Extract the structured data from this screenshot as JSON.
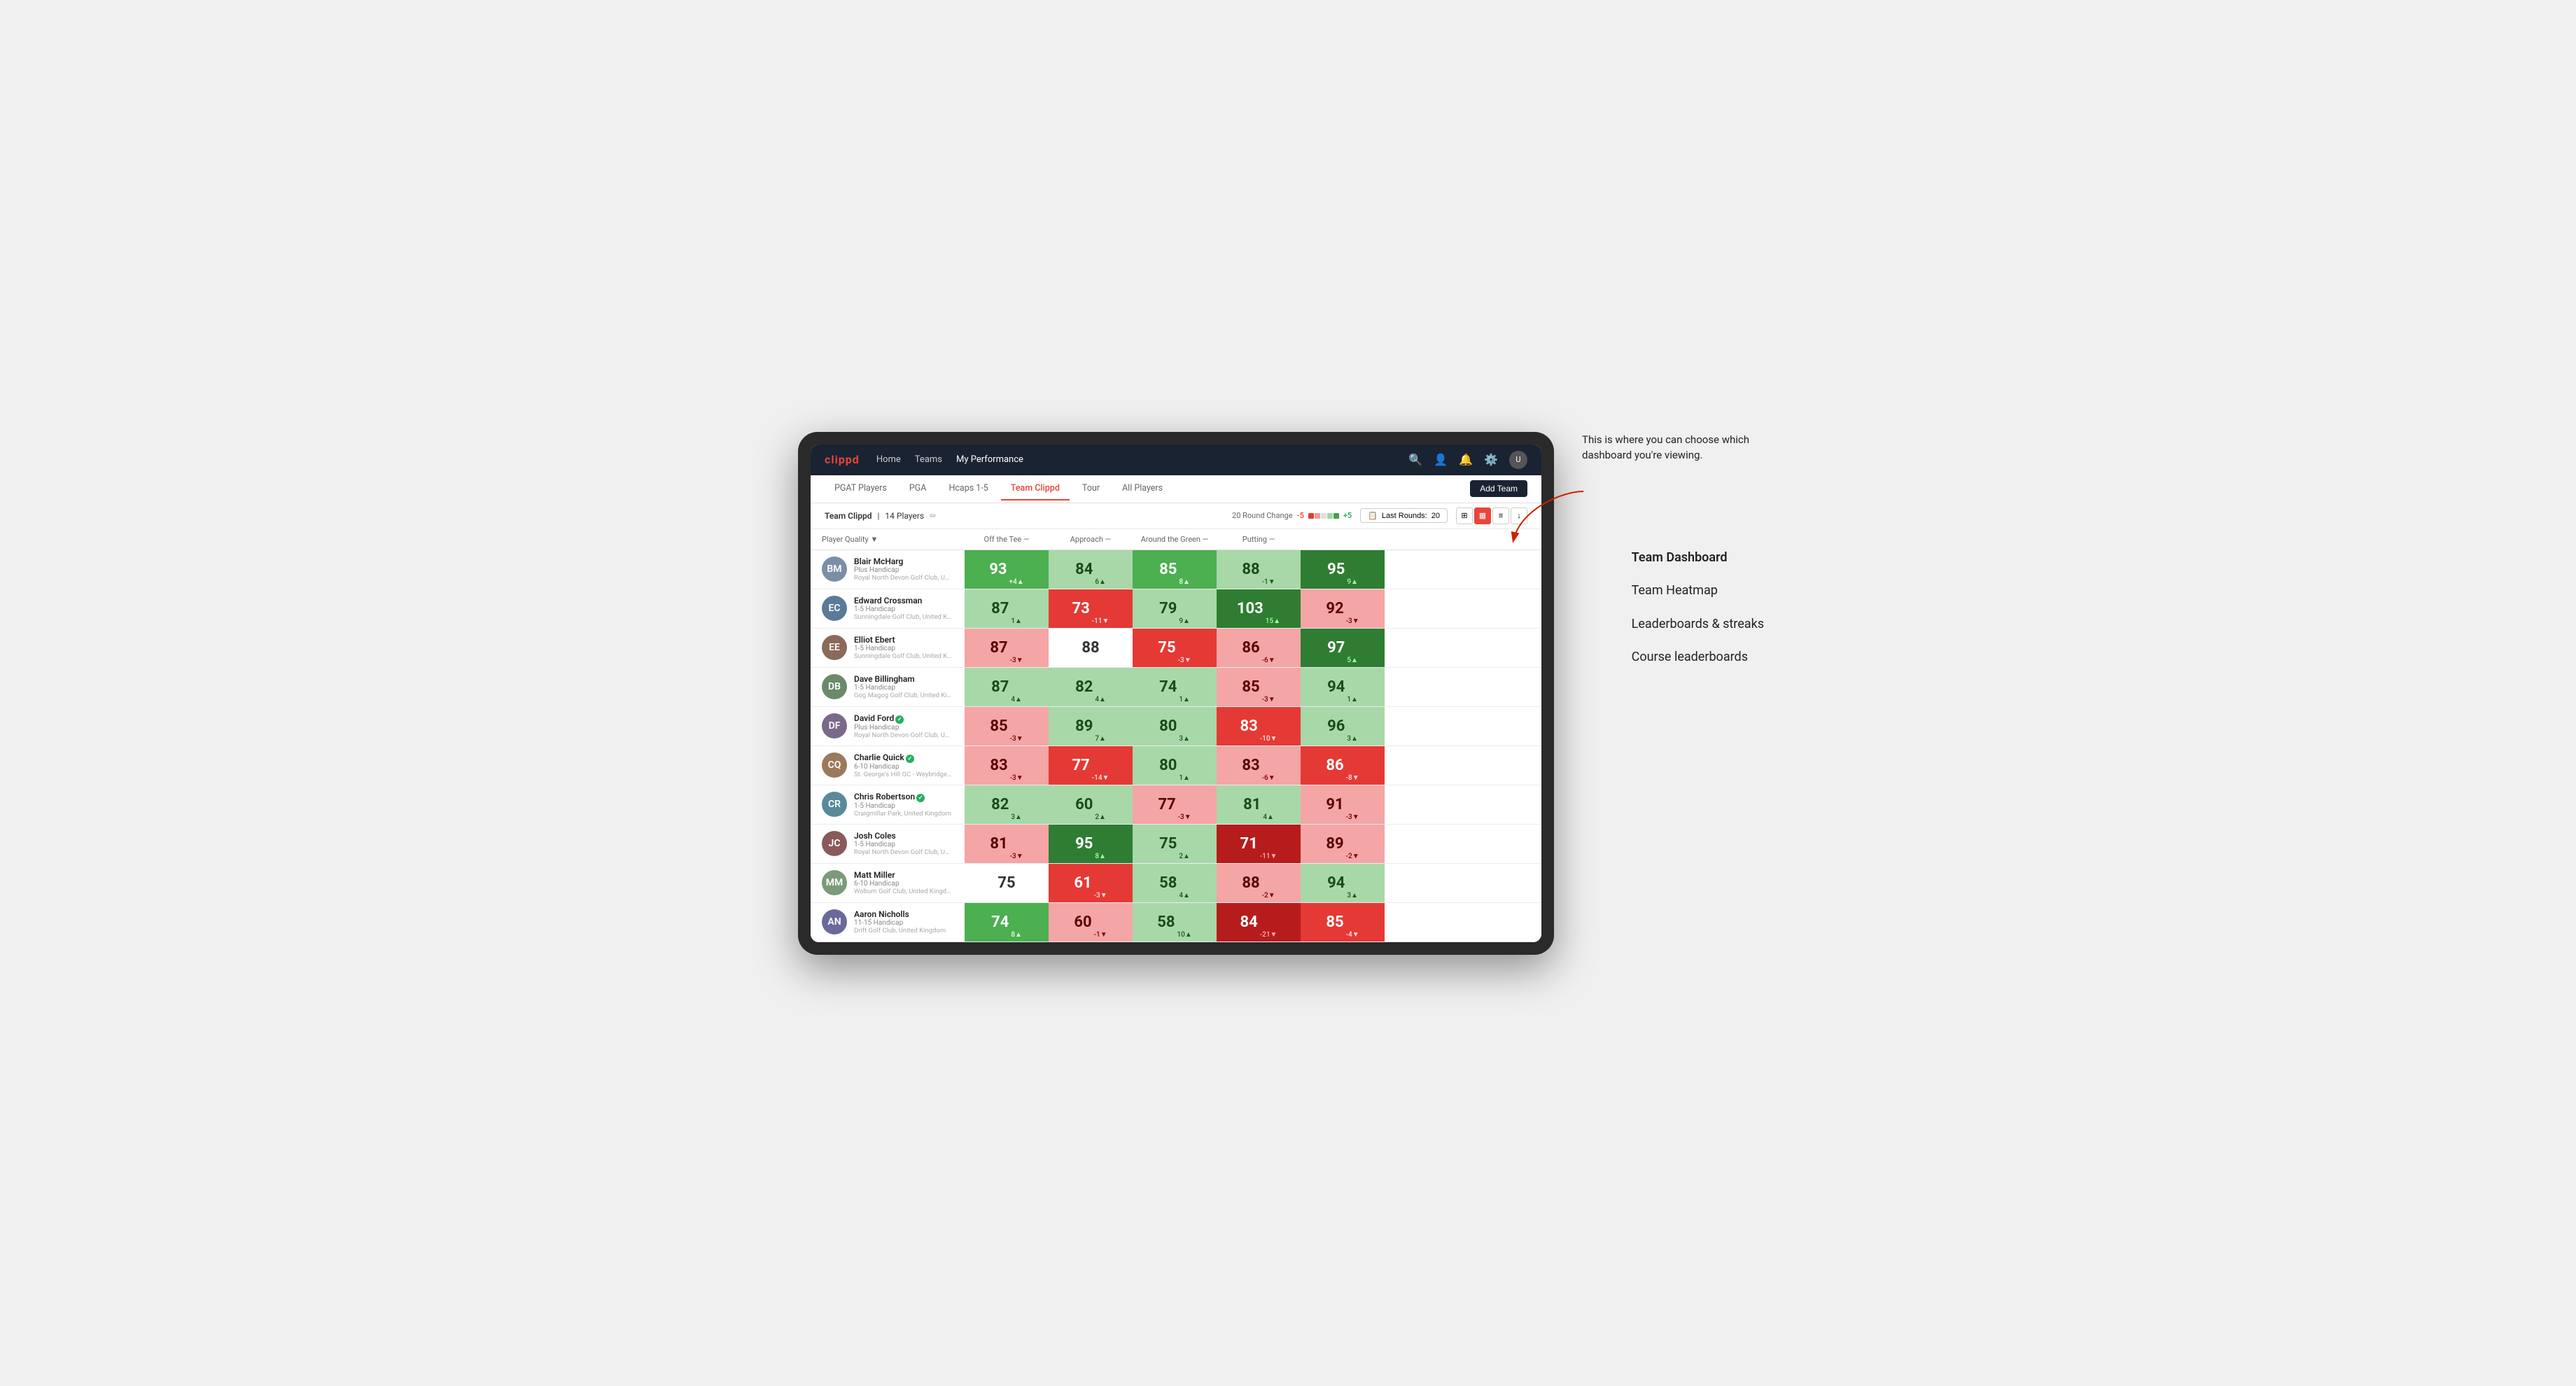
{
  "annotation": {
    "text": "This is where you can choose which dashboard you're viewing.",
    "items": [
      "Team Dashboard",
      "Team Heatmap",
      "Leaderboards & streaks",
      "Course leaderboards"
    ]
  },
  "nav": {
    "logo": "clippd",
    "links": [
      "Home",
      "Teams",
      "My Performance"
    ],
    "active_link": "My Performance"
  },
  "tabs": {
    "items": [
      "PGAT Players",
      "PGA",
      "Hcaps 1-5",
      "Team Clippd",
      "Tour",
      "All Players"
    ],
    "active": "Team Clippd"
  },
  "add_team_label": "Add Team",
  "sub_header": {
    "team_name": "Team Clippd",
    "separator": "|",
    "player_count": "14 Players",
    "round_change_label": "20 Round Change",
    "change_neg": "-5",
    "change_pos": "+5",
    "last_rounds_label": "Last Rounds:",
    "last_rounds_value": "20"
  },
  "columns": {
    "player": "Player Quality ▼",
    "off_tee": "Off the Tee —",
    "approach": "Approach —",
    "around_green": "Around the Green —",
    "putting": "Putting —"
  },
  "players": [
    {
      "name": "Blair McHarg",
      "handicap": "Plus Handicap",
      "club": "Royal North Devon Golf Club, United Kingdom",
      "avatar_color": "#7a8fa6",
      "initials": "BM",
      "scores": {
        "quality": {
          "val": 93,
          "change": "+4",
          "dir": "up",
          "color": "green"
        },
        "tee": {
          "val": 84,
          "change": "6",
          "dir": "up",
          "color": "light-green"
        },
        "approach": {
          "val": 85,
          "change": "8",
          "dir": "up",
          "color": "green"
        },
        "green": {
          "val": 88,
          "change": "-1",
          "dir": "down",
          "color": "light-green"
        },
        "putting": {
          "val": 95,
          "change": "9",
          "dir": "up",
          "color": "dark-green"
        }
      }
    },
    {
      "name": "Edward Crossman",
      "handicap": "1-5 Handicap",
      "club": "Sunningdale Golf Club, United Kingdom",
      "avatar_color": "#5a7a9a",
      "initials": "EC",
      "scores": {
        "quality": {
          "val": 87,
          "change": "1",
          "dir": "up",
          "color": "light-green"
        },
        "tee": {
          "val": 73,
          "change": "-11",
          "dir": "down",
          "color": "red"
        },
        "approach": {
          "val": 79,
          "change": "9",
          "dir": "up",
          "color": "light-green"
        },
        "green": {
          "val": 103,
          "change": "15",
          "dir": "up",
          "color": "dark-green"
        },
        "putting": {
          "val": 92,
          "change": "-3",
          "dir": "down",
          "color": "light-red"
        }
      }
    },
    {
      "name": "Elliot Ebert",
      "handicap": "1-5 Handicap",
      "club": "Sunningdale Golf Club, United Kingdom",
      "avatar_color": "#8a6a5a",
      "initials": "EE",
      "scores": {
        "quality": {
          "val": 87,
          "change": "-3",
          "dir": "down",
          "color": "light-red"
        },
        "tee": {
          "val": 88,
          "change": "",
          "dir": "",
          "color": "white"
        },
        "approach": {
          "val": 75,
          "change": "-3",
          "dir": "down",
          "color": "red"
        },
        "green": {
          "val": 86,
          "change": "-6",
          "dir": "down",
          "color": "light-red"
        },
        "putting": {
          "val": 97,
          "change": "5",
          "dir": "up",
          "color": "dark-green"
        }
      }
    },
    {
      "name": "Dave Billingham",
      "handicap": "1-5 Handicap",
      "club": "Gog Magog Golf Club, United Kingdom",
      "avatar_color": "#6a8a6a",
      "initials": "DB",
      "scores": {
        "quality": {
          "val": 87,
          "change": "4",
          "dir": "up",
          "color": "light-green"
        },
        "tee": {
          "val": 82,
          "change": "4",
          "dir": "up",
          "color": "light-green"
        },
        "approach": {
          "val": 74,
          "change": "1",
          "dir": "up",
          "color": "light-green"
        },
        "green": {
          "val": 85,
          "change": "-3",
          "dir": "down",
          "color": "light-red"
        },
        "putting": {
          "val": 94,
          "change": "1",
          "dir": "up",
          "color": "light-green"
        }
      }
    },
    {
      "name": "David Ford",
      "handicap": "Plus Handicap",
      "club": "Royal North Devon Golf Club, United Kingdom",
      "avatar_color": "#7a6a8a",
      "initials": "DF",
      "verified": true,
      "scores": {
        "quality": {
          "val": 85,
          "change": "-3",
          "dir": "down",
          "color": "light-red"
        },
        "tee": {
          "val": 89,
          "change": "7",
          "dir": "up",
          "color": "light-green"
        },
        "approach": {
          "val": 80,
          "change": "3",
          "dir": "up",
          "color": "light-green"
        },
        "green": {
          "val": 83,
          "change": "-10",
          "dir": "down",
          "color": "red"
        },
        "putting": {
          "val": 96,
          "change": "3",
          "dir": "up",
          "color": "light-green"
        }
      }
    },
    {
      "name": "Charlie Quick",
      "handicap": "6-10 Handicap",
      "club": "St. George's Hill GC - Weybridge, Surrey, Uni...",
      "avatar_color": "#9a7a5a",
      "initials": "CQ",
      "verified": true,
      "scores": {
        "quality": {
          "val": 83,
          "change": "-3",
          "dir": "down",
          "color": "light-red"
        },
        "tee": {
          "val": 77,
          "change": "-14",
          "dir": "down",
          "color": "red"
        },
        "approach": {
          "val": 80,
          "change": "1",
          "dir": "up",
          "color": "light-green"
        },
        "green": {
          "val": 83,
          "change": "-6",
          "dir": "down",
          "color": "light-red"
        },
        "putting": {
          "val": 86,
          "change": "-8",
          "dir": "down",
          "color": "red"
        }
      }
    },
    {
      "name": "Chris Robertson",
      "handicap": "1-5 Handicap",
      "club": "Craigmillar Park, United Kingdom",
      "avatar_color": "#5a8a9a",
      "initials": "CR",
      "verified": true,
      "scores": {
        "quality": {
          "val": 82,
          "change": "3",
          "dir": "up",
          "color": "light-green"
        },
        "tee": {
          "val": 60,
          "change": "2",
          "dir": "up",
          "color": "light-green"
        },
        "approach": {
          "val": 77,
          "change": "-3",
          "dir": "down",
          "color": "light-red"
        },
        "green": {
          "val": 81,
          "change": "4",
          "dir": "up",
          "color": "light-green"
        },
        "putting": {
          "val": 91,
          "change": "-3",
          "dir": "down",
          "color": "light-red"
        }
      }
    },
    {
      "name": "Josh Coles",
      "handicap": "1-5 Handicap",
      "club": "Royal North Devon Golf Club, United Kingdom",
      "avatar_color": "#8a5a5a",
      "initials": "JC",
      "scores": {
        "quality": {
          "val": 81,
          "change": "-3",
          "dir": "down",
          "color": "light-red"
        },
        "tee": {
          "val": 95,
          "change": "8",
          "dir": "up",
          "color": "dark-green"
        },
        "approach": {
          "val": 75,
          "change": "2",
          "dir": "up",
          "color": "light-green"
        },
        "green": {
          "val": 71,
          "change": "-11",
          "dir": "down",
          "color": "dark-red"
        },
        "putting": {
          "val": 89,
          "change": "-2",
          "dir": "down",
          "color": "light-red"
        }
      }
    },
    {
      "name": "Matt Miller",
      "handicap": "6-10 Handicap",
      "club": "Woburn Golf Club, United Kingdom",
      "avatar_color": "#7a9a7a",
      "initials": "MM",
      "scores": {
        "quality": {
          "val": 75,
          "change": "",
          "dir": "",
          "color": "white"
        },
        "tee": {
          "val": 61,
          "change": "-3",
          "dir": "down",
          "color": "red"
        },
        "approach": {
          "val": 58,
          "change": "4",
          "dir": "up",
          "color": "light-green"
        },
        "green": {
          "val": 88,
          "change": "-2",
          "dir": "down",
          "color": "light-red"
        },
        "putting": {
          "val": 94,
          "change": "3",
          "dir": "up",
          "color": "light-green"
        }
      }
    },
    {
      "name": "Aaron Nicholls",
      "handicap": "11-15 Handicap",
      "club": "Drift Golf Club, United Kingdom",
      "avatar_color": "#6a6a9a",
      "initials": "AN",
      "scores": {
        "quality": {
          "val": 74,
          "change": "8",
          "dir": "up",
          "color": "green"
        },
        "tee": {
          "val": 60,
          "change": "-1",
          "dir": "down",
          "color": "light-red"
        },
        "approach": {
          "val": 58,
          "change": "10",
          "dir": "up",
          "color": "light-green"
        },
        "green": {
          "val": 84,
          "change": "-21",
          "dir": "down",
          "color": "dark-red"
        },
        "putting": {
          "val": 85,
          "change": "-4",
          "dir": "down",
          "color": "red"
        }
      }
    }
  ]
}
